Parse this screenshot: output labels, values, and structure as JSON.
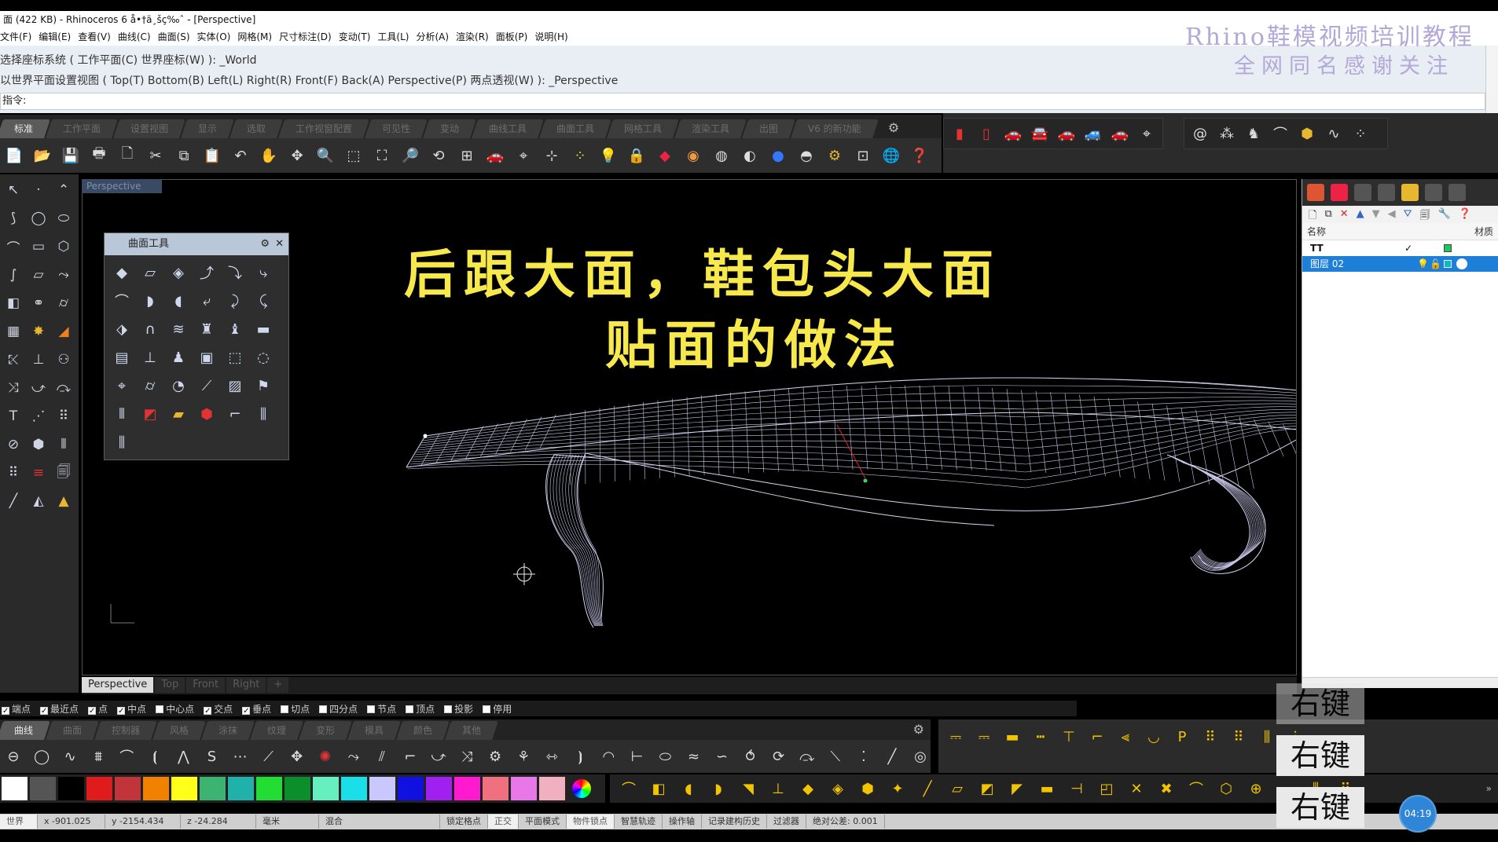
{
  "window": {
    "title": "面 (422 KB) - Rhinoceros 6 å•†ä¸šç‰ˆ - [Perspective]"
  },
  "menu": [
    "文件(F)",
    "编辑(E)",
    "查看(V)",
    "曲线(C)",
    "曲面(S)",
    "实体(O)",
    "网格(M)",
    "尺寸标注(D)",
    "变动(T)",
    "工具(L)",
    "分析(A)",
    "渲染(R)",
    "面板(P)",
    "说明(H)"
  ],
  "watermark": {
    "line1": "Rhino鞋模视频培训教程",
    "line2": "全网同名感谢关注"
  },
  "command": {
    "line1": "选择座标系统 ( 工作平面(C)  世界座标(W) ): _World",
    "line2": "以世界平面设置视图 ( Top(T)  Bottom(B)  Left(L)  Right(R)  Front(F)  Back(A)  Perspective(P)  两点透视(W) ): _Perspective",
    "prompt": "指令:"
  },
  "toolbar_tabs": [
    "标准",
    "工作平面",
    "设置视图",
    "显示",
    "选取",
    "工作视窗配置",
    "可见性",
    "变动",
    "曲线工具",
    "曲面工具",
    "网格工具",
    "渲染工具",
    "出图",
    "V6 的新功能"
  ],
  "viewport": {
    "title": "Perspective",
    "tabs": [
      "Perspective",
      "Top",
      "Front",
      "Right",
      "+"
    ]
  },
  "palette": {
    "title": "曲面工具"
  },
  "overlay": {
    "line1": "后跟大面，鞋包头大面",
    "line2": "贴面的做法"
  },
  "layers": {
    "col_name": "名称",
    "col_material": "材质",
    "rows": [
      {
        "name": "TT",
        "color": "#22c55e",
        "selected": false
      },
      {
        "name": "图层 02",
        "color": "#0fb7c9",
        "selected": true
      }
    ]
  },
  "osnap": [
    {
      "label": "端点",
      "on": true
    },
    {
      "label": "最近点",
      "on": true
    },
    {
      "label": "点",
      "on": true
    },
    {
      "label": "中点",
      "on": true
    },
    {
      "label": "中心点",
      "on": false
    },
    {
      "label": "交点",
      "on": true
    },
    {
      "label": "垂点",
      "on": true
    },
    {
      "label": "切点",
      "on": false
    },
    {
      "label": "四分点",
      "on": false
    },
    {
      "label": "节点",
      "on": false
    },
    {
      "label": "顶点",
      "on": false
    },
    {
      "label": "投影",
      "on": false
    },
    {
      "label": "停用",
      "on": false
    }
  ],
  "bottom_tabs": [
    "曲线",
    "曲面",
    "控制器",
    "风格",
    "涂抹",
    "纹理",
    "变形",
    "模具",
    "颜色",
    "其他"
  ],
  "swatches": [
    "#ffffff",
    "#555555",
    "#000000",
    "#e01b1b",
    "#c0343a",
    "#f08200",
    "#ffff1a",
    "#3cb371",
    "#20b2aa",
    "#22dd33",
    "#0a8f2a",
    "#66f0c0",
    "#1adfe8",
    "#c8c8ff",
    "#1010e0",
    "#a020f0",
    "#ff1ad0",
    "#f07080",
    "#e878e8",
    "#f0b0c0"
  ],
  "status": {
    "cplane": "世界",
    "x": "x -901.025",
    "y": "y -2154.434",
    "z": "z -24.284",
    "units": "毫米",
    "layer": "混合",
    "items": [
      "锁定格点",
      "正交",
      "平面模式",
      "物件锁点",
      "智慧轨迹",
      "操作轴",
      "记录建构历史",
      "过滤器",
      "绝对公差: 0.001"
    ]
  },
  "rightkey": [
    "右键",
    "右键",
    "右键"
  ],
  "timer": "04:19"
}
